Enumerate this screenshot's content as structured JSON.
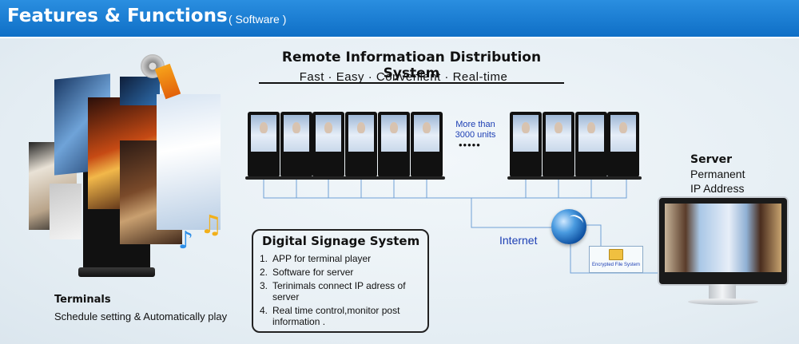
{
  "header": {
    "title": "Features & Functions",
    "subtitle": "( Software )",
    "color": "#1a7fd4"
  },
  "system": {
    "title": "Remote Informatioan Distribution System",
    "features": "Fast ·   Easy ·   Convenient  ·   Real-time"
  },
  "display_units": {
    "more_label_line1": "More than",
    "more_label_line2": "3000 units",
    "ellipsis": "•••••"
  },
  "signage_box": {
    "title": "Digital Signage System",
    "items": [
      {
        "num": "1.",
        "text": "APP for terminal player"
      },
      {
        "num": "2.",
        "text": "Software for server"
      },
      {
        "num": "3.",
        "text": "Terinimals connect IP adress of server"
      },
      {
        "num": "4.",
        "text": "Real time control,monitor post information ."
      }
    ]
  },
  "terminals": {
    "title": "Terminals",
    "description": "Schedule setting & Automatically play"
  },
  "server": {
    "title": "Server",
    "line1": "Permanent",
    "line2": "IP Address"
  },
  "network": {
    "internet_label": "Internet",
    "encrypted_label": "Encrypted File System",
    "wire_color": "#6fa0d6"
  }
}
